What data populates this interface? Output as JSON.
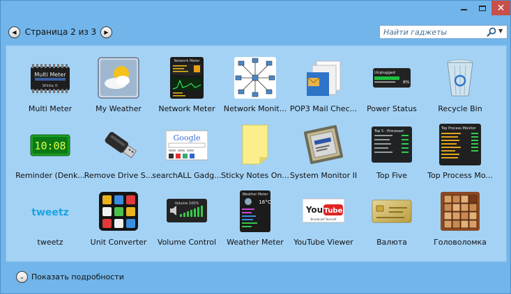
{
  "window": {
    "minimize_icon": "minimize-icon",
    "maximize_icon": "maximize-icon",
    "close_glyph": "✕"
  },
  "navigation": {
    "page_label": "Страница 2 из 3",
    "prev_glyph": "◀",
    "next_glyph": "▶"
  },
  "search": {
    "placeholder": "Найти гаджеты",
    "dropdown_glyph": "▼"
  },
  "gadgets": [
    {
      "label": "Multi Meter",
      "icon": "multi-meter-icon"
    },
    {
      "label": "My Weather",
      "icon": "weather-icon"
    },
    {
      "label": "Network Meter",
      "icon": "network-meter-icon"
    },
    {
      "label": "Network Monit...",
      "icon": "network-monitor-icon"
    },
    {
      "label": "POP3 Mail Chec...",
      "icon": "mail-icon"
    },
    {
      "label": "Power Status",
      "icon": "battery-icon"
    },
    {
      "label": "Recycle Bin",
      "icon": "recycle-bin-icon"
    },
    {
      "label": "Reminder (Denk...",
      "icon": "digital-clock-icon"
    },
    {
      "label": "Remove Drive S...",
      "icon": "usb-drive-icon"
    },
    {
      "label": "searchALL Gadg...",
      "icon": "google-search-icon"
    },
    {
      "label": "Sticky Notes On...",
      "icon": "sticky-note-icon"
    },
    {
      "label": "System Monitor II",
      "icon": "cpu-chip-icon"
    },
    {
      "label": "Top Five",
      "icon": "top-five-icon"
    },
    {
      "label": "Top Process Mo...",
      "icon": "top-process-icon"
    },
    {
      "label": "tweetz",
      "icon": "tweetz-icon"
    },
    {
      "label": "Unit Converter",
      "icon": "unit-converter-icon"
    },
    {
      "label": "Volume Control",
      "icon": "volume-icon"
    },
    {
      "label": "Weather Meter",
      "icon": "weather-meter-icon"
    },
    {
      "label": "YouTube Viewer",
      "icon": "youtube-icon"
    },
    {
      "label": "Валюта",
      "icon": "currency-card-icon"
    },
    {
      "label": "Головоломка",
      "icon": "puzzle-icon"
    }
  ],
  "thumb_text": {
    "multi_meter_title": "Multi Meter",
    "multi_meter_brand": "SFkilla ©",
    "network_meter_title": "Network Meter",
    "power_title": "Unplugged",
    "power_pct": "8%",
    "reminder_time": "10:08",
    "google_word": "Google",
    "top_five_title": "Top 5 - Processor",
    "top_process_title": "Top Process Monitor",
    "tweetz_word": "tweetz",
    "volume_title": "Volume 100%",
    "weather_meter_title": "Weather Meter",
    "weather_meter_temp": "16°C",
    "youtube_you": "You",
    "youtube_tube": "Tube",
    "youtube_tag": "Broadcast Yourself"
  },
  "footer": {
    "details_label": "Показать подробности",
    "expand_glyph": "⌄"
  },
  "colors": {
    "window_bg": "#71b5ea",
    "content_bg": "#a4d2f5",
    "close_red": "#c7504a"
  }
}
